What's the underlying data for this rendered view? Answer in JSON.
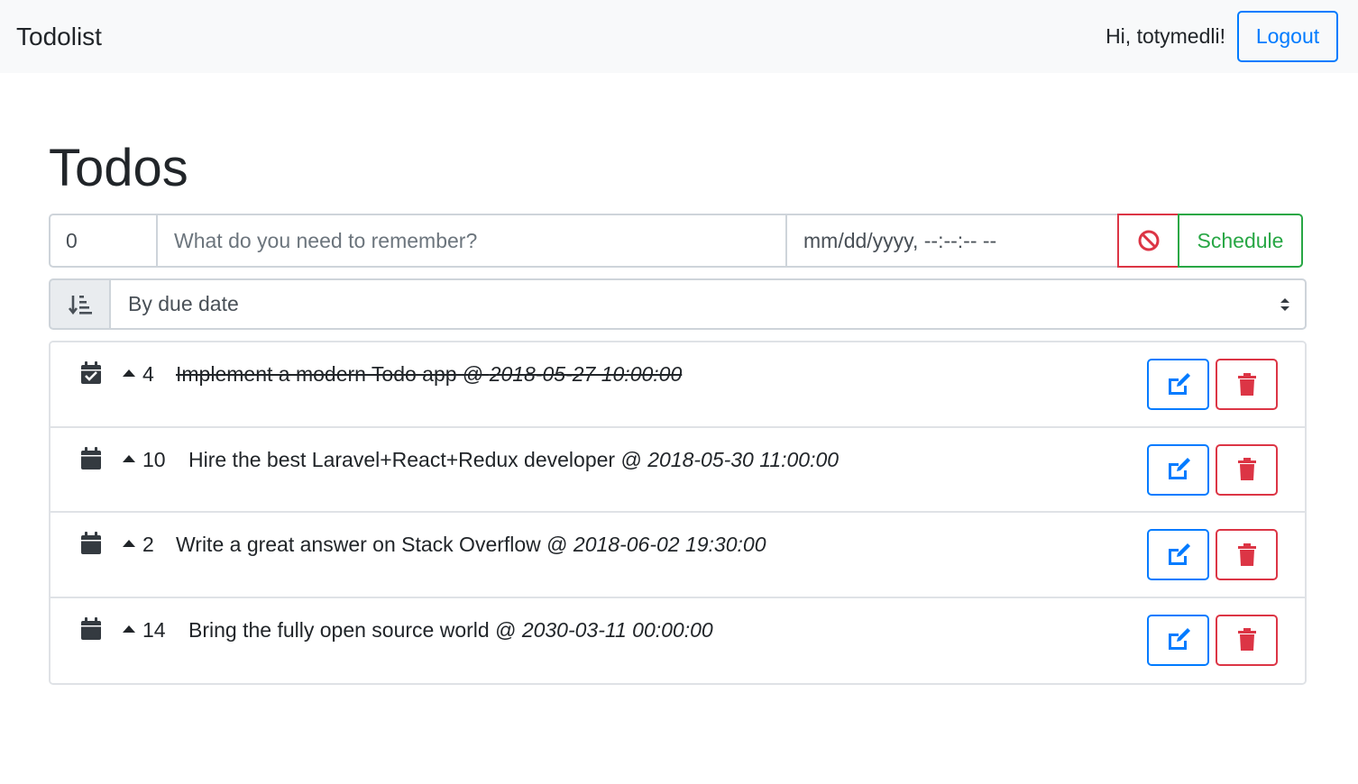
{
  "navbar": {
    "brand": "Todolist",
    "greeting": "Hi, totymedli!",
    "logout_label": "Logout"
  },
  "page": {
    "title": "Todos"
  },
  "form": {
    "priority_value": "0",
    "text_placeholder": "What do you need to remember?",
    "date_placeholder": "mm/dd/yyyy, --:--:-- --",
    "clear_icon": "ban-icon",
    "schedule_label": "Schedule"
  },
  "sort": {
    "icon": "sort-amount-down-icon",
    "selected": "By due date"
  },
  "todos": [
    {
      "done": true,
      "icon": "calendar-check-icon",
      "priority": "4",
      "text": "Implement a modern Todo app @ ",
      "due": "2018-05-27 10:00:00"
    },
    {
      "done": false,
      "icon": "calendar-icon",
      "priority": "10",
      "text": "Hire the best Laravel+React+Redux developer @ ",
      "due": "2018-05-30 11:00:00"
    },
    {
      "done": false,
      "icon": "calendar-icon",
      "priority": "2",
      "text": "Write a great answer on Stack Overflow @ ",
      "due": "2018-06-02 19:30:00"
    },
    {
      "done": false,
      "icon": "calendar-icon",
      "priority": "14",
      "text": "Bring the fully open source world @ ",
      "due": "2030-03-11 00:00:00"
    }
  ],
  "colors": {
    "primary": "#007bff",
    "danger": "#dc3545",
    "success": "#28a745",
    "navbar_bg": "#f8f9fa"
  }
}
